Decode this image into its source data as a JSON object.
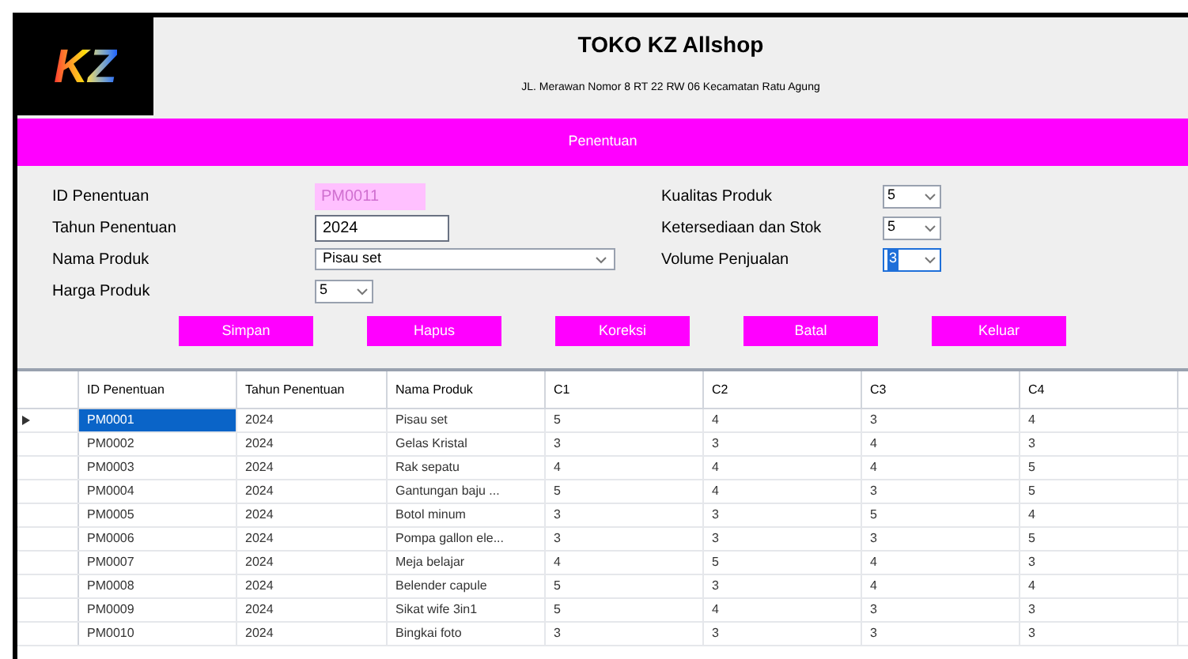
{
  "header": {
    "title": "TOKO KZ Allshop",
    "address": "JL. Merawan Nomor 8 RT 22 RW 06 Kecamatan Ratu Agung",
    "logo_text": "KZ"
  },
  "banner": "Penentuan",
  "form": {
    "left": [
      {
        "kind": "readonly",
        "label": "ID Penentuan",
        "value": "PM0011"
      },
      {
        "kind": "text",
        "label": "Tahun Penentuan",
        "value": "2024"
      },
      {
        "kind": "wide-select",
        "label": "Nama Produk",
        "value": "Pisau set"
      },
      {
        "kind": "select",
        "label": "Harga Produk",
        "value": "5"
      }
    ],
    "right": [
      {
        "kind": "select",
        "label": "Kualitas Produk",
        "value": "5",
        "selected": false
      },
      {
        "kind": "select",
        "label": "Ketersediaan dan Stok",
        "value": "5",
        "selected": false
      },
      {
        "kind": "select",
        "label": "Volume Penjualan",
        "value": "3",
        "selected": true
      }
    ]
  },
  "buttons": [
    "Simpan",
    "Hapus",
    "Koreksi",
    "Batal",
    "Keluar"
  ],
  "table": {
    "columns": [
      "ID Penentuan",
      "Tahun Penentuan",
      "Nama Produk",
      "C1",
      "C2",
      "C3",
      "C4"
    ],
    "rows": [
      {
        "cells": [
          "PM0001",
          "2024",
          "Pisau set",
          "5",
          "4",
          "3",
          "4"
        ],
        "selected": true
      },
      {
        "cells": [
          "PM0002",
          "2024",
          "Gelas Kristal",
          "3",
          "3",
          "4",
          "3"
        ],
        "selected": false
      },
      {
        "cells": [
          "PM0003",
          "2024",
          "Rak sepatu",
          "4",
          "4",
          "4",
          "5"
        ],
        "selected": false
      },
      {
        "cells": [
          "PM0004",
          "2024",
          "Gantungan baju ...",
          "5",
          "4",
          "3",
          "5"
        ],
        "selected": false
      },
      {
        "cells": [
          "PM0005",
          "2024",
          "Botol minum",
          "3",
          "3",
          "5",
          "4"
        ],
        "selected": false
      },
      {
        "cells": [
          "PM0006",
          "2024",
          "Pompa gallon ele...",
          "3",
          "3",
          "3",
          "5"
        ],
        "selected": false
      },
      {
        "cells": [
          "PM0007",
          "2024",
          "Meja belajar",
          "4",
          "5",
          "4",
          "3"
        ],
        "selected": false
      },
      {
        "cells": [
          "PM0008",
          "2024",
          "Belender capule",
          "5",
          "3",
          "4",
          "4"
        ],
        "selected": false
      },
      {
        "cells": [
          "PM0009",
          "2024",
          "Sikat wife 3in1",
          "5",
          "4",
          "3",
          "3"
        ],
        "selected": false
      },
      {
        "cells": [
          "PM0010",
          "2024",
          "Bingkai foto",
          "3",
          "3",
          "3",
          "3"
        ],
        "selected": false
      }
    ]
  }
}
